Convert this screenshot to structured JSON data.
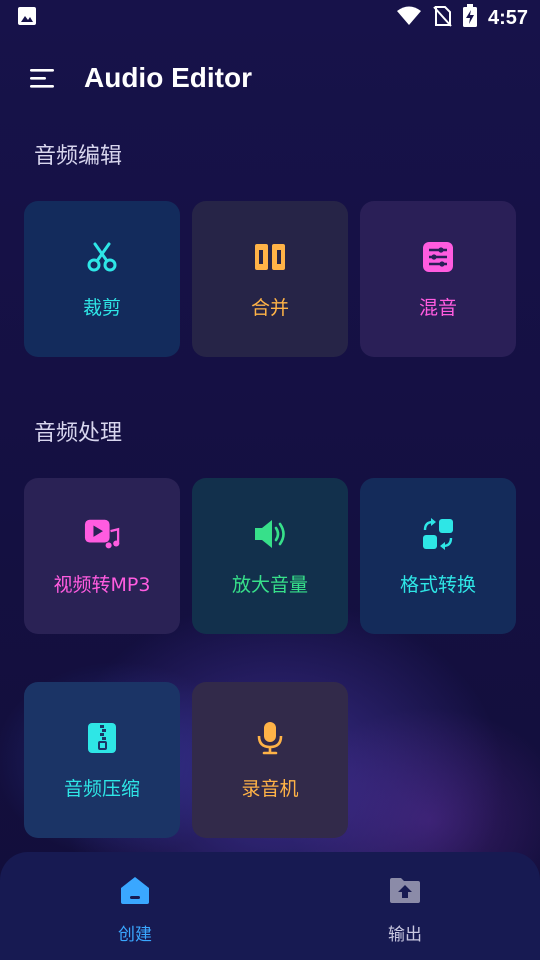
{
  "status_bar": {
    "time": "4:57",
    "icons": [
      "image-icon",
      "wifi-icon",
      "no-sim-icon",
      "battery-charging-icon"
    ]
  },
  "app_bar": {
    "menu_icon": "menu-icon",
    "title": "Audio Editor"
  },
  "sections": [
    {
      "title": "音频编辑",
      "items": [
        {
          "label": "裁剪",
          "icon": "scissors-icon",
          "color": "#2ee6e6"
        },
        {
          "label": "合并",
          "icon": "merge-icon",
          "color": "#ffb347"
        },
        {
          "label": "混音",
          "icon": "mixer-icon",
          "color": "#ff5ce0"
        }
      ]
    },
    {
      "title": "音频处理",
      "items": [
        {
          "label": "视频转MP3",
          "icon": "video-music-icon",
          "color": "#ff5ce0"
        },
        {
          "label": "放大音量",
          "icon": "volume-up-icon",
          "color": "#37e08a"
        },
        {
          "label": "格式转换",
          "icon": "format-convert-icon",
          "color": "#2ee6e6"
        },
        {
          "label": "音频压缩",
          "icon": "zip-file-icon",
          "color": "#2ee6e6"
        },
        {
          "label": "录音机",
          "icon": "microphone-icon",
          "color": "#ffb347"
        }
      ]
    }
  ],
  "bottom_nav": {
    "items": [
      {
        "label": "创建",
        "icon": "home-icon",
        "active": true,
        "color": "#3aa7ff"
      },
      {
        "label": "输出",
        "icon": "folder-upload-icon",
        "active": false,
        "color": "#c9c8e0"
      }
    ]
  }
}
